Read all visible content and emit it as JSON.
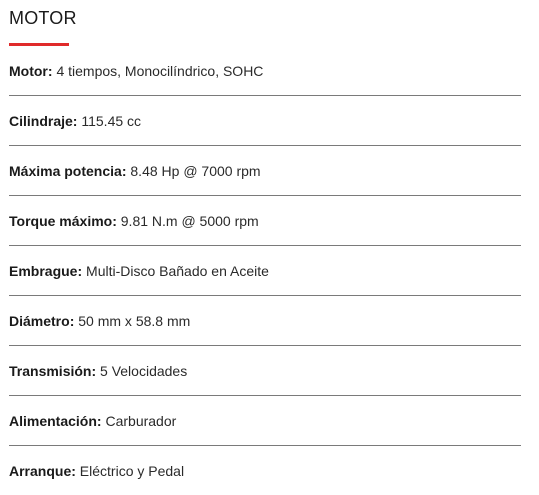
{
  "section": {
    "title": "MOTOR",
    "accent_color": "#e02a2a"
  },
  "specs": [
    {
      "label": "Motor",
      "value": "4 tiempos, Monocilíndrico, SOHC"
    },
    {
      "label": "Cilindraje",
      "value": "115.45 cc"
    },
    {
      "label": "Máxima potencia",
      "value": "8.48 Hp @ 7000 rpm"
    },
    {
      "label": "Torque máximo",
      "value": "9.81 N.m @ 5000 rpm"
    },
    {
      "label": "Embrague",
      "value": "Multi-Disco Bañado en Aceite"
    },
    {
      "label": "Diámetro",
      "value": "50 mm x 58.8 mm"
    },
    {
      "label": "Transmisión",
      "value": "5 Velocidades"
    },
    {
      "label": "Alimentación",
      "value": "Carburador"
    },
    {
      "label": "Arranque",
      "value": "Eléctrico y Pedal"
    }
  ]
}
